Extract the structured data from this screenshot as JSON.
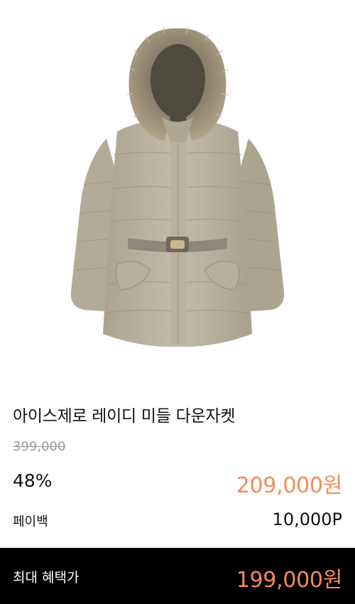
{
  "product": {
    "image_icon": "down-jacket-image",
    "title": "아이스제로 레이디 미들 다운자켓",
    "original_price": "399,000",
    "discount_rate": "48%",
    "sale_price": "209,000원",
    "payback_label": "페이백",
    "payback_value": "10,000P"
  },
  "benefit_bar": {
    "label": "최대 혜택가",
    "price": "199,000원"
  },
  "colors": {
    "accent": "#f58a5b",
    "bar_background": "#000000",
    "jacket": "#bcb6a3"
  }
}
